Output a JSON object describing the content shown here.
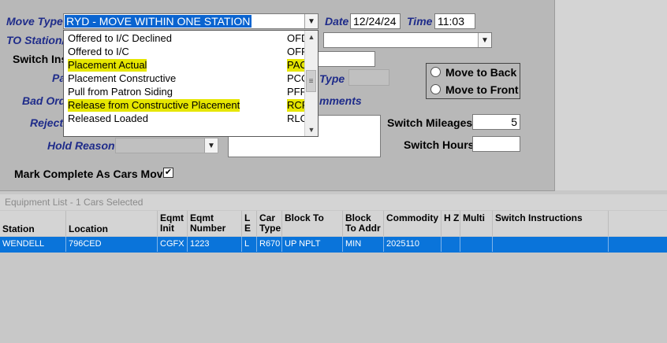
{
  "form": {
    "move_type_label": "Move Type",
    "move_type_value": "RYD - MOVE WITHIN ONE STATION",
    "date_label": "Date",
    "date_value": "12/24/24",
    "time_label": "Time",
    "time_value": "11:03",
    "to_station_label": "TO Station/S",
    "switch_ins_label": "Switch Ins",
    "pa_label": "Pa",
    "type_label": "Type",
    "bad_ord_label": "Bad Ord",
    "comments_label": "mments",
    "reject_label": "Reject",
    "hold_reason_label": "Hold Reason",
    "switch_mileages_label": "Switch Mileages",
    "switch_mileages_value": "5",
    "switch_hours_label": "Switch Hours",
    "switch_hours_value": "",
    "move_to_back_label": "Move to Back",
    "move_to_front_label": "Move to Front",
    "mark_complete_label": "Mark Complete As Cars Move",
    "mark_complete_checked": "✔"
  },
  "dropdown": {
    "items": [
      {
        "label": "Offered to I/C Declined",
        "code": "OFD",
        "highlighted": false
      },
      {
        "label": "Offered to I/C",
        "code": "OFF",
        "highlighted": false
      },
      {
        "label": "Placement Actual",
        "code": "PAC",
        "highlighted": true
      },
      {
        "label": "Placement Constructive",
        "code": "PCC",
        "highlighted": false
      },
      {
        "label": "Pull from Patron Siding",
        "code": "PFP",
        "highlighted": false
      },
      {
        "label": "Release from Constructive Placement",
        "code": "RCP",
        "highlighted": true
      },
      {
        "label": "Released Loaded",
        "code": "RLO",
        "highlighted": false
      }
    ]
  },
  "equipment": {
    "title": "Equipment List - 1 Cars Selected",
    "columns": [
      {
        "key": "station",
        "label": "Station"
      },
      {
        "key": "location",
        "label": "Location"
      },
      {
        "key": "eqmt_init",
        "label": "Eqmt Init"
      },
      {
        "key": "eqmt_number",
        "label": "Eqmt Number"
      },
      {
        "key": "le",
        "label": "L E"
      },
      {
        "key": "car_type",
        "label": "Car Type"
      },
      {
        "key": "block_to",
        "label": "Block To"
      },
      {
        "key": "block_to_addr",
        "label": "Block To Addr"
      },
      {
        "key": "commodity",
        "label": "Commodity"
      },
      {
        "key": "hz",
        "label": "H Z"
      },
      {
        "key": "multi",
        "label": "Multi"
      },
      {
        "key": "switch_instructions",
        "label": "Switch Instructions"
      }
    ],
    "rows": [
      {
        "station": "WENDELL",
        "location": "796CED",
        "eqmt_init": "CGFX",
        "eqmt_number": "1223",
        "le": "L",
        "car_type": "R670",
        "block_to": "UP NPLT",
        "block_to_addr": "MIN",
        "commodity": "2025110",
        "hz": "",
        "multi": "",
        "switch_instructions": ""
      }
    ]
  },
  "colors": {
    "label_blue": "#1f2c8a",
    "selection_blue": "#0a74da",
    "highlight_yellow": "#e6e600"
  }
}
